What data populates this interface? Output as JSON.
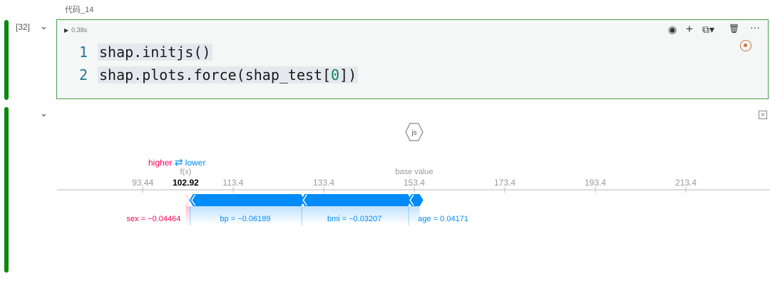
{
  "cell": {
    "label": "代码_14",
    "exec_count": "[32]",
    "run_time": "0.38s",
    "lines": [
      {
        "no": "1",
        "text": "shap.initjs()"
      },
      {
        "no": "2",
        "pre": "shap.plots.force(shap_test[",
        "num": "0",
        "post": "])"
      }
    ],
    "toolbar": {
      "eye": "◉",
      "plus": "+",
      "copy": "⧉▾",
      "trash": "🗑",
      "more": "···"
    }
  },
  "output": {
    "js_label": "js",
    "close_glyph": "×"
  },
  "chart_data": {
    "type": "force",
    "higher_label": "higher",
    "lower_label": "lower",
    "arrows": "⇄",
    "fx_label": "f(x)",
    "fx_value": 102.92,
    "fx_text": "102.92",
    "base_label": "base value",
    "base_value": 153.4,
    "ticks": [
      93.44,
      113.4,
      133.4,
      153.4,
      173.4,
      193.4,
      213.4
    ],
    "tick_labels": [
      "93.44",
      "113.4",
      "133.4",
      "153.4",
      "173.4",
      "193.4",
      "213.4"
    ],
    "features": [
      {
        "name": "sex",
        "text": "sex = −0.04464",
        "start": 102.92,
        "end": 103.75,
        "direction": "higher"
      },
      {
        "name": "bp",
        "text": "bp = −0.06189",
        "start": 103.75,
        "end": 128.4,
        "direction": "lower"
      },
      {
        "name": "bmi",
        "text": "bmi = −0.03207",
        "start": 128.4,
        "end": 152.0,
        "direction": "lower"
      },
      {
        "name": "age",
        "text": "age = 0.04171",
        "start": 152.0,
        "end": 154.6,
        "direction": "lower"
      }
    ],
    "colors": {
      "higher": "#ff0051",
      "lower": "#008bfb",
      "axis": "#999999"
    }
  }
}
